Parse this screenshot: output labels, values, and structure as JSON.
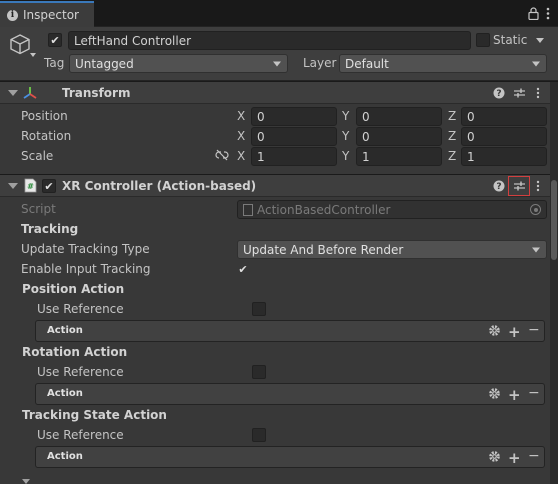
{
  "tab": {
    "title": "Inspector"
  },
  "object": {
    "name": "LeftHand Controller",
    "active_checked": true,
    "static_label": "Static",
    "static_checked": false,
    "tag_label": "Tag",
    "tag_value": "Untagged",
    "layer_label": "Layer",
    "layer_value": "Default"
  },
  "transform": {
    "title": "Transform",
    "rows": [
      {
        "label": "Position",
        "x": "0",
        "y": "0",
        "z": "0"
      },
      {
        "label": "Rotation",
        "x": "0",
        "y": "0",
        "z": "0"
      },
      {
        "label": "Scale",
        "x": "1",
        "y": "1",
        "z": "1"
      }
    ],
    "axis": {
      "x": "X",
      "y": "Y",
      "z": "Z"
    }
  },
  "xr": {
    "title": "XR Controller (Action-based)",
    "enabled": true,
    "script_label": "Script",
    "script_value": "ActionBasedController",
    "tracking_header": "Tracking",
    "update_type_label": "Update Tracking Type",
    "update_type_value": "Update And Before Render",
    "enable_input_label": "Enable Input Tracking",
    "enable_input_checked": true,
    "position_action": {
      "title": "Position Action",
      "use_ref_label": "Use Reference",
      "box_label": "Action"
    },
    "rotation_action": {
      "title": "Rotation Action",
      "use_ref_label": "Use Reference",
      "box_label": "Action"
    },
    "tracking_state_action": {
      "title": "Tracking State Action",
      "use_ref_label": "Use Reference",
      "box_label": "Action"
    }
  },
  "icons": [
    "info-icon",
    "lock-icon",
    "menu-icon",
    "cube-icon",
    "transform-axes-icon",
    "help-icon",
    "presets-icon",
    "kebab-icon",
    "script-icon",
    "link-broken-icon",
    "gear-icon",
    "plus-icon",
    "minus-icon",
    "target-icon",
    "checkmark-icon"
  ],
  "colors": {
    "highlight": "#d23f3f",
    "tab_accent": "#3a79bb",
    "bg": "#383838"
  }
}
